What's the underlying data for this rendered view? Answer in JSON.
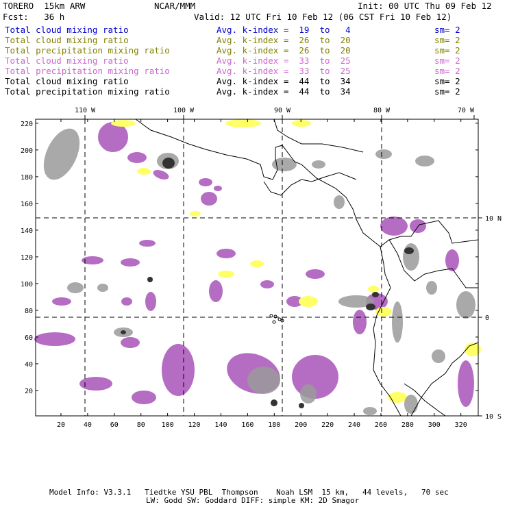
{
  "header": {
    "model": "TORERO  15km ARW",
    "org": "NCAR/MMM",
    "init": "Init: 00 UTC Thu 09 Feb 12",
    "fcst": "Fcst:   36 h",
    "valid": "Valid: 12 UTC Fri 10 Feb 12 (06 CST Fri 10 Feb 12)"
  },
  "legend": [
    {
      "field": "Total cloud mixing ratio",
      "kindex": "Avg. k-index =  19  to   4",
      "sm": "sm= 2",
      "color": "#0000cc"
    },
    {
      "field": "Total cloud mixing ratio",
      "kindex": "Avg. k-index =  26  to  20",
      "sm": "sm= 2",
      "color": "#808000"
    },
    {
      "field": "Total precipitation mixing ratio",
      "kindex": "Avg. k-index =  26  to  20",
      "sm": "sm= 2",
      "color": "#808000"
    },
    {
      "field": "Total cloud mixing ratio",
      "kindex": "Avg. k-index =  33  to  25",
      "sm": "sm= 2",
      "color": "#cc66cc"
    },
    {
      "field": "Total precipitation mixing ratio",
      "kindex": "Avg. k-index =  33  to  25",
      "sm": "sm= 2",
      "color": "#cc66cc"
    },
    {
      "field": "Total cloud mixing ratio",
      "kindex": "Avg. k-index =  44  to  34",
      "sm": "sm= 2",
      "color": "#000000"
    },
    {
      "field": "Total precipitation mixing ratio",
      "kindex": "Avg. k-index =  44  to  34",
      "sm": "sm= 2",
      "color": "#000000"
    }
  ],
  "map": {
    "lon_labels": [
      "110 W",
      "100 W",
      "90 W",
      "80 W",
      "70 W"
    ],
    "lat_labels": [
      "10 N",
      "0",
      "10 S"
    ],
    "x_ticks": [
      "20",
      "40",
      "60",
      "80",
      "100",
      "120",
      "140",
      "160",
      "180",
      "200",
      "220",
      "240",
      "260",
      "280",
      "300",
      "320"
    ],
    "y_ticks": [
      "20",
      "40",
      "60",
      "80",
      "100",
      "120",
      "140",
      "160",
      "180",
      "200",
      "220"
    ],
    "colors": {
      "magenta": "#b56dc4",
      "yellow": "#ffff66",
      "gray": "#9a9a9a",
      "dark_gray": "#333333",
      "coast": "#000000"
    }
  },
  "footer": {
    "line1": "Model Info: V3.3.1   Tiedtke YSU PBL  Thompson    Noah LSM  15 km,   44 levels,   70 sec",
    "line2": "LW: Godd SW: Goddard DIFF: simple KM: 2D Smagor"
  }
}
